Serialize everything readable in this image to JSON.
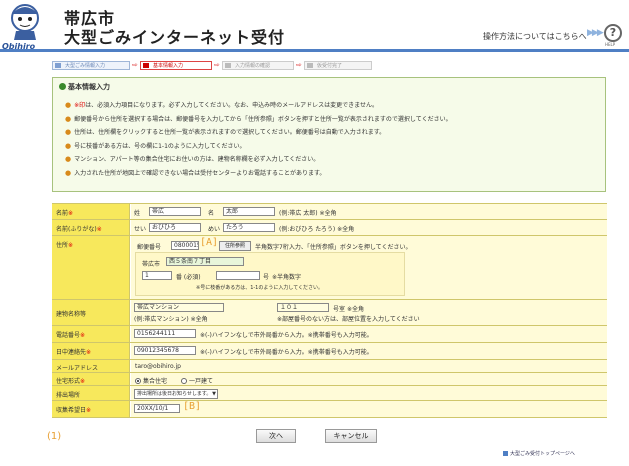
{
  "header": {
    "title_line1": "帯広市",
    "title_line2": "大型ごみインターネット受付",
    "logo_text": "Obihiro",
    "help_link": "操作方法についてはこちらへ",
    "help_arrows": "▶▶▶",
    "help_icon_glyph": "?",
    "help_label": "HELP"
  },
  "steps": [
    {
      "label": "大型ごみ情報入力",
      "state": "done"
    },
    {
      "label": "基本情報入力",
      "state": "current"
    },
    {
      "label": "入力情報の確認",
      "state": "pending"
    },
    {
      "label": "仮受付完了",
      "state": "pending"
    }
  ],
  "step_arrow": "⇨",
  "info": {
    "title": "基本情報入力",
    "bullet": "●",
    "items": [
      {
        "prefix": "※印",
        "text": "は、必須入力項目になります。必ず入力してください。なお、申込み時のメールアドレスは変更できません。"
      },
      {
        "prefix": "",
        "text": "郵便番号から住所を選択する場合は、郵便番号を入力してから「住所参照」ボタンを押すと住所一覧が表示されますので選択してください。"
      },
      {
        "prefix": "",
        "text": "住所は、住所欄をクリックすると住所一覧が表示されますので選択してください。郵便番号は自動で入力されます。"
      },
      {
        "prefix": "",
        "text": "号に枝番がある方は、号の欄に1-1のように入力してください。"
      },
      {
        "prefix": "",
        "text": "マンション、アパート等の集合住宅にお住いの方は、建物名称欄を必ず入力してください。"
      },
      {
        "prefix": "",
        "text": "入力された住所が地図上で確認できない場合は受付センターよりお電話することがあります。"
      }
    ]
  },
  "form": {
    "req_mark": "※",
    "name": {
      "label": "名前",
      "sei_label": "姓",
      "sei_value": "帯広",
      "mei_label": "名",
      "mei_value": "太郎",
      "note": "(例:帯広 太郎) ※全角"
    },
    "kana": {
      "label": "名前(ふりがな)",
      "sei_label": "せい",
      "sei_value": "おびひろ",
      "mei_label": "めい",
      "mei_value": "たろう",
      "note": "(例:おびひろ たろう) ※全角"
    },
    "address": {
      "label": "住所",
      "zip_label": "郵便番号",
      "zip_value": "0800015",
      "annotation_a": "[A]",
      "lookup_button": "住所参照",
      "zip_note": "半角数字7桁入力、「住所参照」ボタンを押してください。",
      "city": "帯広市",
      "street_value": "西５条南７丁目",
      "banchi_value": "1",
      "banchi_label": "番 (必須)",
      "go_label": "号",
      "go_note": "※半角数字",
      "branch_note": "※号に枝番がある方は、1-1のように入力してください。"
    },
    "building": {
      "label": "建物名称等",
      "name_value": "帯広マンション",
      "name_note": "(例:帯広マンション) ※全角",
      "room_value": "１０１",
      "room_label": "号室",
      "room_req": "※全角",
      "room_note": "※部屋番号のない方は、部屋位置を入力してください"
    },
    "phone": {
      "label": "電話番号",
      "value": "0156244111",
      "note": "※(-)ハイフンなしで市外局番から入力。※携帯番号も入力可能。"
    },
    "daytime": {
      "label": "日中連絡先",
      "value": "09012345678",
      "note": "※(-)ハイフンなしで市外局番から入力。※携帯番号も入力可能。"
    },
    "email": {
      "label": "メールアドレス",
      "value": "taro@obihiro.jp"
    },
    "housing": {
      "label": "住宅形式",
      "options": [
        "集合住宅",
        "一戸建て"
      ],
      "selected": 0
    },
    "dropoff": {
      "label": "排出場所",
      "value": "排出場所は後日お知らせします。"
    },
    "date": {
      "label": "収集希望日",
      "value": "20XX/10/1",
      "annotation_b": "[B]"
    }
  },
  "footer": {
    "figure_label": "(1)",
    "next_button": "次へ",
    "cancel_button": "キャンセル",
    "top_link": "大型ごみ受付トップページへ"
  },
  "colors": {
    "label_bg": "#f7e85c",
    "value_bg": "#fffbd8",
    "required": "#dd0000",
    "annotation": "#e8a033",
    "header_rule": "#4f7fc4"
  }
}
